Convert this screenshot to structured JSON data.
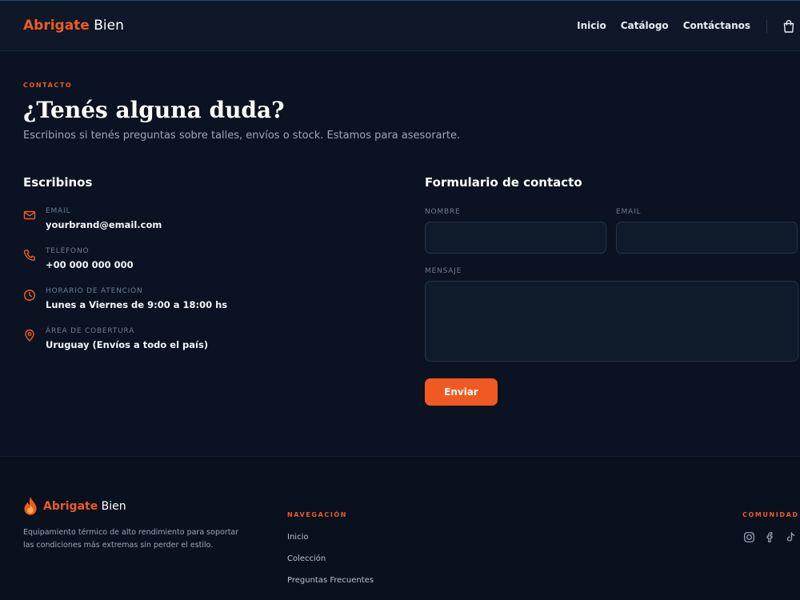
{
  "header": {
    "brand_primary": "Abrigate",
    "brand_secondary": "Bien",
    "nav": [
      "Inicio",
      "Catálogo",
      "Contáctanos"
    ],
    "cart_icon": "shopping-bag-icon"
  },
  "contact": {
    "eyebrow": "CONTACTO",
    "title": "¿Tenés alguna duda?",
    "subtitle": "Escribinos si tenés preguntas sobre talles, envíos o stock. Estamos para asesorarte."
  },
  "info": {
    "title": "Escribinos",
    "items": [
      {
        "icon": "mail-icon",
        "label": "EMAIL",
        "value": "yourbrand@email.com"
      },
      {
        "icon": "phone-icon",
        "label": "TELÉFONO",
        "value": "+00 000 000 000"
      },
      {
        "icon": "clock-icon",
        "label": "HORARIO DE ATENCIÓN",
        "value": "Lunes a Viernes de 9:00 a 18:00 hs"
      },
      {
        "icon": "map-pin-icon",
        "label": "ÁREA DE COBERTURA",
        "value": "Uruguay (Envíos a todo el país)"
      }
    ]
  },
  "form": {
    "title": "Formulario de contacto",
    "name_label": "NOMBRE",
    "name_value": "",
    "email_label": "EMAIL",
    "email_value": "",
    "message_label": "MENSAJE",
    "message_value": "",
    "submit_label": "Enviar"
  },
  "footer": {
    "brand_primary": "Abrigate",
    "brand_secondary": "Bien",
    "brand_icon": "flame-icon",
    "description": "Equipamiento térmico de alto rendimiento para soportar las condiciones más extremas sin perder el estilo.",
    "nav_heading": "NAVEGACIÓN",
    "nav_links": [
      "Inicio",
      "Colección",
      "Preguntas Frecuentes"
    ],
    "community_heading": "COMUNIDAD",
    "social_icons": [
      "instagram-icon",
      "facebook-icon",
      "tiktok-icon"
    ]
  },
  "colors": {
    "accent": "#f05a22",
    "background": "#0b1322",
    "header_bg": "#0e1828",
    "footer_bg": "#0a111e",
    "muted_text": "#9aa6b8"
  }
}
